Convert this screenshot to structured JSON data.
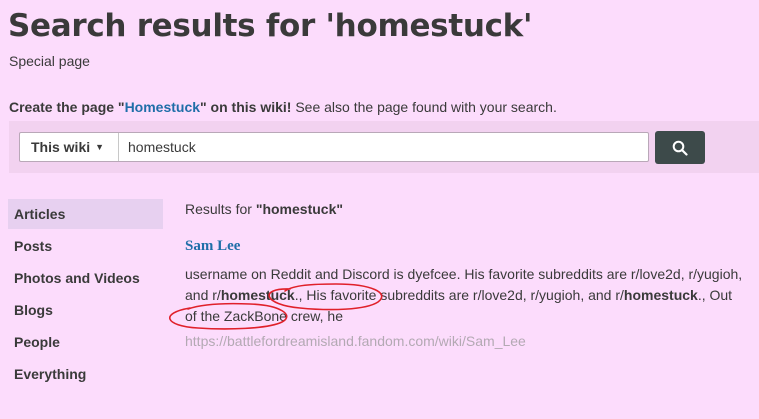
{
  "header": {
    "title": "Search results for 'homestuck'",
    "subtitle": "Special page"
  },
  "create_notice": {
    "prefix": "Create the page \"",
    "page_name": "Homestuck",
    "middle": "\" on this wiki!",
    "suffix": " See also the page found with your search."
  },
  "search": {
    "scope_label": "This wiki",
    "query": "homestuck",
    "button_icon": "search-icon"
  },
  "sidebar": {
    "items": [
      {
        "label": "Articles",
        "active": true
      },
      {
        "label": "Posts"
      },
      {
        "label": "Photos and Videos"
      },
      {
        "label": "Blogs"
      },
      {
        "label": "People"
      },
      {
        "label": "Everything"
      }
    ]
  },
  "results": {
    "results_for_prefix": "Results for ",
    "results_for_query": "\"homestuck\"",
    "items": [
      {
        "title": "Sam Lee",
        "snippet_1": "username on Reddit and Discord is dyefcee. His favorite subreddits are r/love2d, r/yugioh, and r/",
        "match_1": "homestuck",
        "snippet_2": "., His favorite subreddits are r/love2d, r/yugioh, and r/",
        "match_2": "homestuck",
        "snippet_3": "., Out of the ZackBone crew, he",
        "url": "https://battlefordreamisland.fandom.com/wiki/Sam_Lee"
      }
    ]
  },
  "colors": {
    "background": "#fcdcfc",
    "link": "#1f6ea8",
    "annotation": "#e0202a",
    "search_button": "#3d4a4a"
  }
}
